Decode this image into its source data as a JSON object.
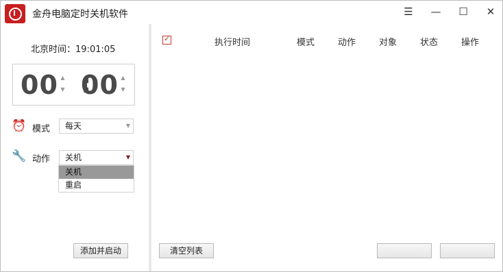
{
  "window": {
    "title": "金舟电脑定时关机软件",
    "controls": {
      "menu": "☰",
      "minimize": "—",
      "maximize": "☐",
      "close": "✕"
    }
  },
  "clock": {
    "label": "北京时间：",
    "time": "19:01:05"
  },
  "timer": {
    "hours": "00",
    "separator": ":",
    "minutes": "00",
    "up": "▲",
    "down": "▼"
  },
  "mode": {
    "icon": "alarm-clock-icon",
    "label": "模式",
    "value": "每天",
    "arrow": "▼"
  },
  "action": {
    "icon": "wrench-icon",
    "label": "动作",
    "value": "关机",
    "arrow": "▼",
    "options": [
      "关机",
      "重启"
    ]
  },
  "buttons": {
    "add_start": "添加并启动",
    "clear_list": "清空列表"
  },
  "table": {
    "checkbox": "✓",
    "columns": [
      "执行时间",
      "模式",
      "动作",
      "对象",
      "状态",
      "操作"
    ]
  },
  "colors": {
    "accent": "#c0392b",
    "logo": "#c81e1e",
    "selected_option": "#999999"
  }
}
